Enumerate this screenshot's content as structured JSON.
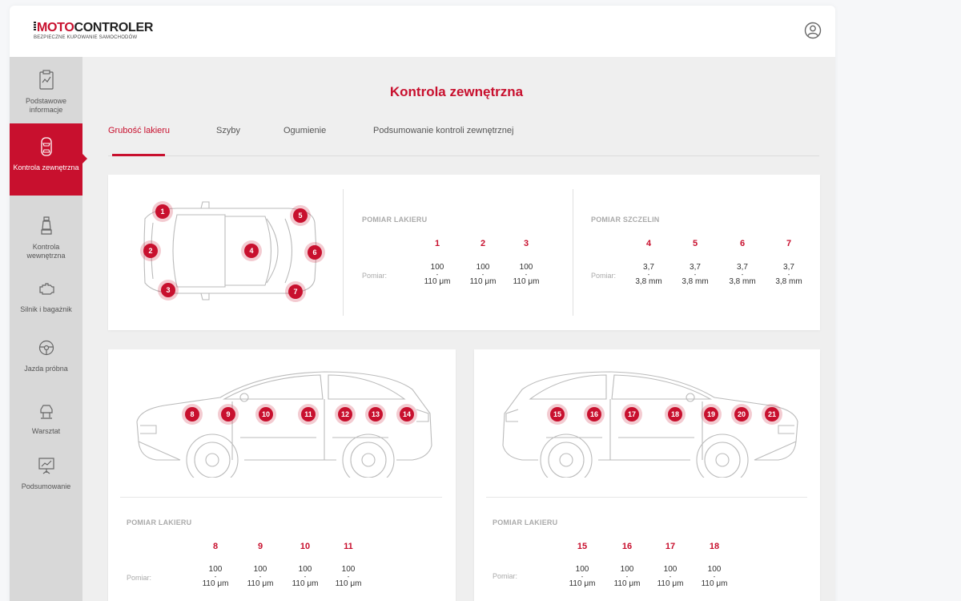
{
  "header": {
    "logo_prefix": "MOTO",
    "logo_suffix": "CONTROLER",
    "tagline": "BEZPIECZNE KUPOWANIE SAMOCHODÓW",
    "user_icon": "user-circle-icon"
  },
  "sidebar": {
    "items": [
      {
        "label": "Podstawowe informacje",
        "icon": "clipboard-icon",
        "active": false
      },
      {
        "label": "Kontrola zewnętrzna",
        "icon": "car-top-icon",
        "active": true
      },
      {
        "label": "Kontrola wewnętrzna",
        "icon": "car-seat-icon",
        "active": false
      },
      {
        "label": "Silnik i bagażnik",
        "icon": "engine-icon",
        "active": false
      },
      {
        "label": "Jazda próbna",
        "icon": "steering-wheel-icon",
        "active": false
      },
      {
        "label": "Warsztat",
        "icon": "car-lift-icon",
        "active": false
      },
      {
        "label": "Podsumowanie",
        "icon": "presentation-chart-icon",
        "active": false
      }
    ]
  },
  "page": {
    "title": "Kontrola zewnętrzna",
    "tabs": [
      {
        "label": "Grubość lakieru",
        "active": true
      },
      {
        "label": "Szyby",
        "active": false
      },
      {
        "label": "Ogumienie",
        "active": false
      },
      {
        "label": "Podsumowanie kontroli zewnętrznej",
        "active": false
      }
    ]
  },
  "top_card": {
    "markers": [
      "1",
      "2",
      "3",
      "4",
      "5",
      "6",
      "7"
    ],
    "paint": {
      "label": "POMIAR LAKIERU",
      "row_label": "Pomiar:",
      "columns": [
        {
          "num": "1",
          "low": "100",
          "high": "110 μm"
        },
        {
          "num": "2",
          "low": "100",
          "high": "110 μm"
        },
        {
          "num": "3",
          "low": "100",
          "high": "110 μm"
        }
      ]
    },
    "gaps": {
      "label": "POMIAR SZCZELIN",
      "row_label": "Pomiar:",
      "columns": [
        {
          "num": "4",
          "low": "3,7",
          "high": "3,8 mm"
        },
        {
          "num": "5",
          "low": "3,7",
          "high": "3,8 mm"
        },
        {
          "num": "6",
          "low": "3,7",
          "high": "3,8 mm"
        },
        {
          "num": "7",
          "low": "3,7",
          "high": "3,8 mm"
        }
      ]
    }
  },
  "left_card": {
    "markers": [
      "8",
      "9",
      "10",
      "11",
      "12",
      "13",
      "14"
    ],
    "label": "POMIAR LAKIERU",
    "row_label": "Pomiar:",
    "columns": [
      {
        "num": "8",
        "low": "100",
        "high": "110 μm"
      },
      {
        "num": "9",
        "low": "100",
        "high": "110 μm"
      },
      {
        "num": "10",
        "low": "100",
        "high": "110 μm"
      },
      {
        "num": "11",
        "low": "100",
        "high": "110 μm"
      }
    ]
  },
  "right_card": {
    "markers": [
      "15",
      "16",
      "17",
      "18",
      "19",
      "20",
      "21"
    ],
    "label": "POMIAR LAKIERU",
    "row_label": "Pomiar:",
    "columns": [
      {
        "num": "15",
        "low": "100",
        "high": "110 μm"
      },
      {
        "num": "16",
        "low": "100",
        "high": "110 μm"
      },
      {
        "num": "17",
        "low": "100",
        "high": "110 μm"
      },
      {
        "num": "18",
        "low": "100",
        "high": "110 μm"
      }
    ]
  },
  "colors": {
    "accent": "#c8102e",
    "sidebar": "#d8d8d8",
    "content_bg": "#efefef"
  }
}
